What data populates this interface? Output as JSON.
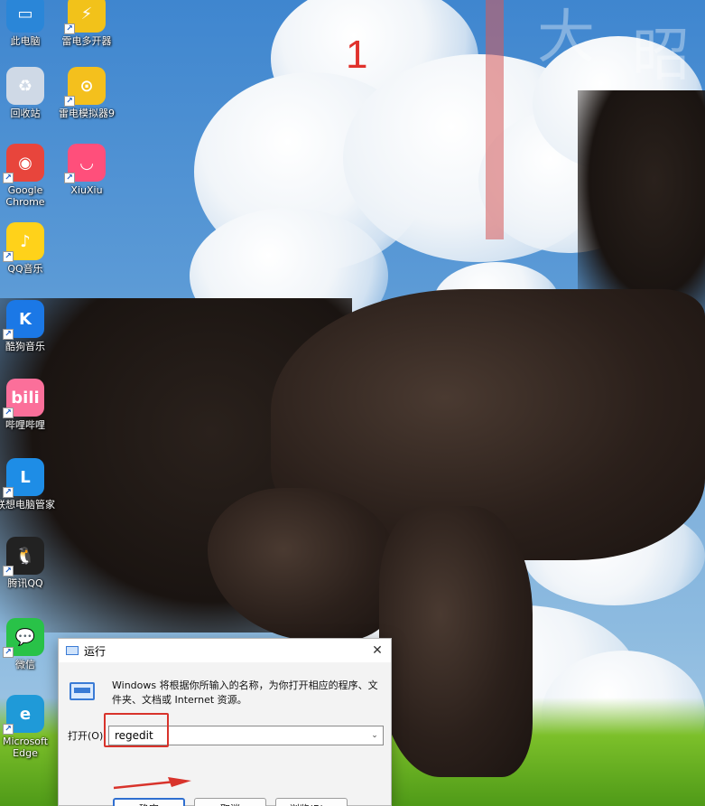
{
  "desktop_icons": [
    {
      "label": "此电脑",
      "color": "#2a86d8",
      "glyph": "▭",
      "icon": "computer-icon"
    },
    {
      "label": "雷电多开器",
      "color": "#f2c21a",
      "glyph": "⚡",
      "icon": "ldmultiplayer-icon"
    },
    {
      "label": "回收站",
      "color": "#cfd9e6",
      "glyph": "♻",
      "icon": "recycle-bin-icon"
    },
    {
      "label": "雷电模拟器9",
      "color": "#f4c01d",
      "glyph": "⊙",
      "icon": "ldplayer-icon"
    },
    {
      "label": "Google\nChrome",
      "color": "#e8453c",
      "glyph": "◉",
      "icon": "chrome-icon"
    },
    {
      "label": "XiuXiu",
      "color": "#ff4f7b",
      "glyph": "◡",
      "icon": "xiuxiu-icon"
    },
    {
      "label": "QQ音乐",
      "color": "#ffd21a",
      "glyph": "♪",
      "icon": "qq-music-icon"
    },
    {
      "label": "酷狗音乐",
      "color": "#1b78e6",
      "glyph": "K",
      "icon": "kugou-icon"
    },
    {
      "label": "哔哩哔哩",
      "color": "#fb6f9a",
      "glyph": "bili",
      "icon": "bilibili-icon"
    },
    {
      "label": "联想电脑管家",
      "color": "#1e8de6",
      "glyph": "L",
      "icon": "lenovo-manager-icon"
    },
    {
      "label": "腾讯QQ",
      "color": "#222222",
      "glyph": "🐧",
      "icon": "qq-icon"
    },
    {
      "label": "微信",
      "color": "#29c248",
      "glyph": "💬",
      "icon": "wechat-icon"
    },
    {
      "label": "Microsoft\nEdge",
      "color": "#1f9ad8",
      "glyph": "e",
      "icon": "edge-icon"
    }
  ],
  "annotation_number": "1",
  "run_dialog": {
    "title": "运行",
    "close_symbol": "✕",
    "description": "Windows 将根据你所输入的名称，为你打开相应的程序、文件夹、文档或 Internet 资源。",
    "open_label": "打开(O):",
    "open_value": "regedit",
    "buttons": {
      "ok": "确定",
      "cancel": "取消",
      "browse": "浏览(B)..."
    }
  },
  "colors": {
    "highlight": "#d8332b",
    "accent": "#2f6fd0"
  }
}
